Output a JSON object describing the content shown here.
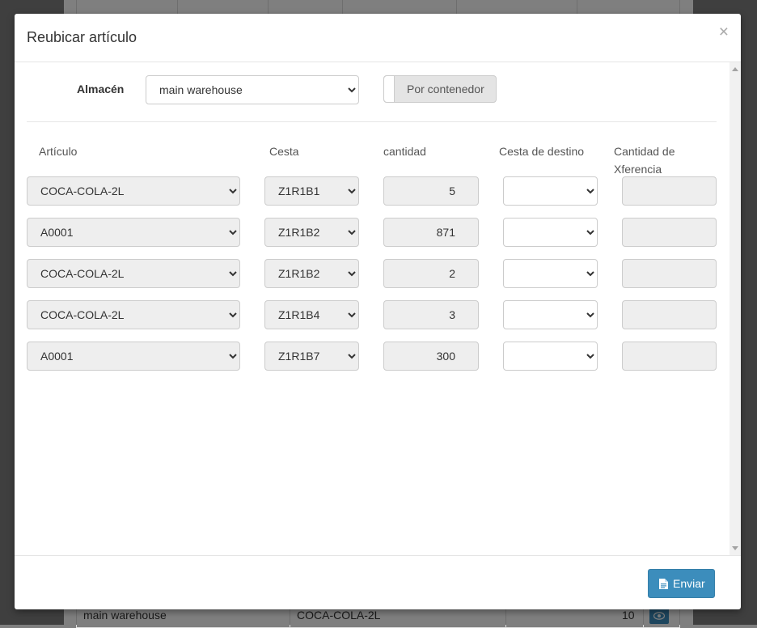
{
  "modal": {
    "title": "Reubicar artículo",
    "close_label": "×",
    "almacen_label": "Almacén",
    "almacen_value": "main warehouse",
    "toggle_label": "Por contenedor",
    "columns": {
      "articulo": "Artículo",
      "cesta": "Cesta",
      "cantidad": "cantidad",
      "cesta_destino": "Cesta de destino",
      "cantidad_xfer_line1": "Cantidad de",
      "cantidad_xfer_line2": "Xferencia"
    },
    "rows": [
      {
        "articulo": "COCA-COLA-2L",
        "cesta": "Z1R1B1",
        "cantidad": "5"
      },
      {
        "articulo": "A0001",
        "cesta": "Z1R1B2",
        "cantidad": "871"
      },
      {
        "articulo": "COCA-COLA-2L",
        "cesta": "Z1R1B2",
        "cantidad": "2"
      },
      {
        "articulo": "COCA-COLA-2L",
        "cesta": "Z1R1B4",
        "cantidad": "3"
      },
      {
        "articulo": "A0001",
        "cesta": "Z1R1B7",
        "cantidad": "300"
      }
    ],
    "submit_label": "Enviar",
    "submit_icon": "file-text-icon"
  },
  "background": {
    "warehouse": "main warehouse",
    "item": "COCA-COLA-2L",
    "quantity": "10",
    "action_icon": "eye-icon"
  },
  "colors": {
    "primary": "#3c8dbc",
    "overlay": "rgba(0,0,0,0.5)"
  }
}
